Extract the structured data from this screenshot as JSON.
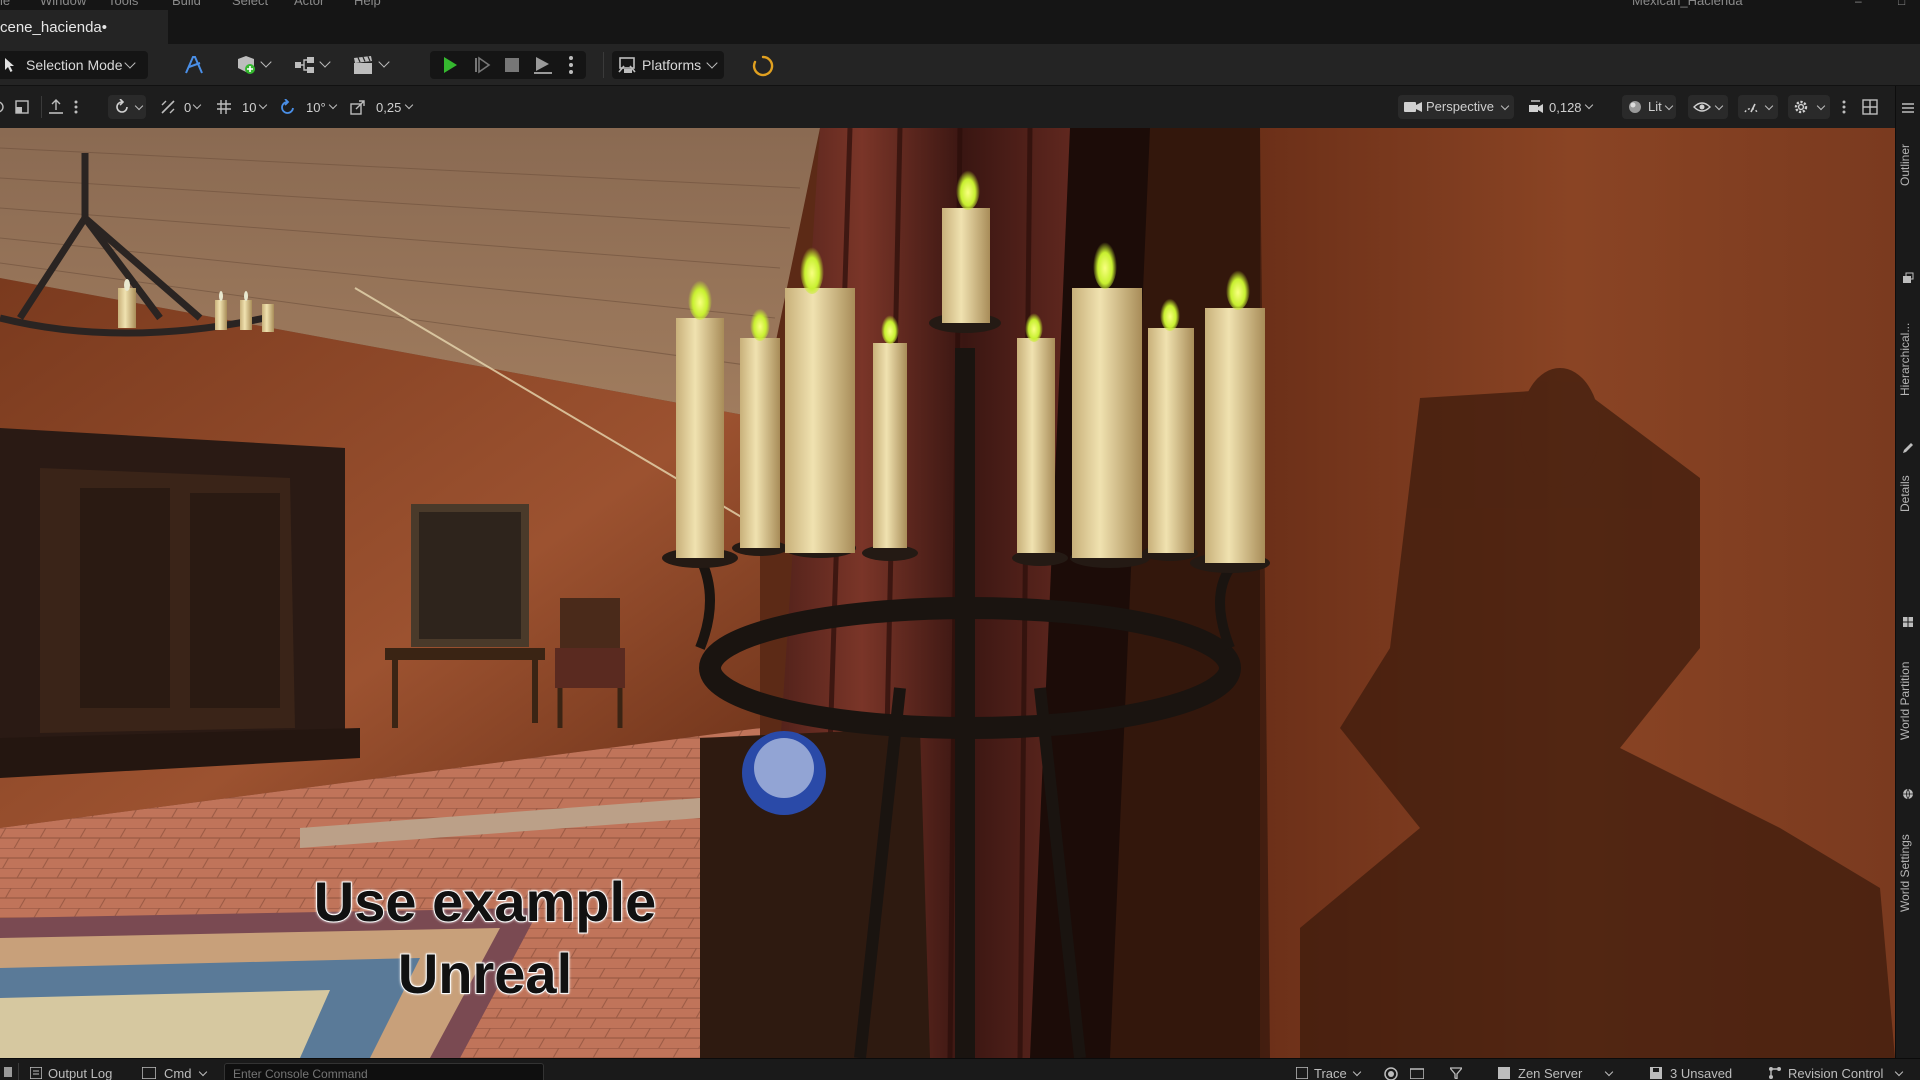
{
  "menu": {
    "items": [
      "le",
      "Window",
      "Tools",
      "Build",
      "Select",
      "Actor",
      "Help"
    ],
    "project_name": "Mexican_Hacienda"
  },
  "tab": {
    "document_title": "cene_hacienda•"
  },
  "toolbar": {
    "selection_mode_label": "Selection Mode",
    "platforms_label": "Platforms"
  },
  "viewport_toolbar": {
    "rotation_value": "0",
    "grid_snap_value": "10",
    "rotation_snap_value": "10°",
    "scale_snap_value": "0,25",
    "view_mode_label": "Perspective",
    "camera_speed_value": "0,128",
    "lighting_mode_label": "Lit"
  },
  "viewport": {
    "overlay_line1": "Use example",
    "overlay_line2": "Unreal"
  },
  "side_tabs": {
    "outliner": "Outliner",
    "hierarchical": "Hierarchical...",
    "details": "Details",
    "world_partition": "World Partition",
    "world_settings": "World Settings"
  },
  "statusbar": {
    "output_log": "Output Log",
    "cmd": "Cmd",
    "console_placeholder": "Enter Console Command",
    "trace": "Trace",
    "zen_server": "Zen Server",
    "unsaved": "3 Unsaved",
    "revision_control": "Revision Control"
  },
  "colors": {
    "play_green": "#35b82f",
    "accent_blue": "#4a8fe7",
    "spinner_orange": "#e0a020"
  }
}
